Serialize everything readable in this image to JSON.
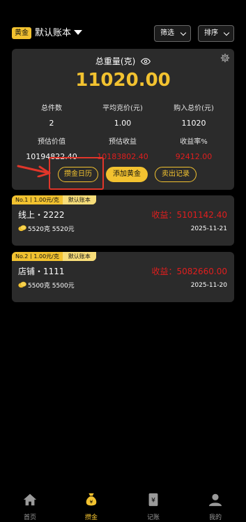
{
  "header": {
    "badge": "黄金",
    "account_name": "默认账本",
    "filter_label": "筛选",
    "sort_label": "排序"
  },
  "summary": {
    "title": "总重量(克)",
    "total_weight": "11020.00",
    "stats": [
      {
        "label": "总件数",
        "value": "2"
      },
      {
        "label": "平均克价(元)",
        "value": "1.00"
      },
      {
        "label": "购入总价(元)",
        "value": "11020"
      },
      {
        "label": "预估价值",
        "value": "10194822.40"
      },
      {
        "label": "预估收益",
        "value": "10183802.40"
      },
      {
        "label": "收益率%",
        "value": "92412.00"
      }
    ],
    "buttons": {
      "calendar": "攒金日历",
      "add": "添加黄金",
      "sell": "卖出记录"
    }
  },
  "records": [
    {
      "number": "No.1丨1.00元/克",
      "account": "默认账本",
      "title": "线上・2222",
      "profit": "收益：5101142.40",
      "weight": "5520克 5520元",
      "date": "2025-11-21"
    },
    {
      "number": "No.2丨1.00元/克",
      "account": "默认账本",
      "title": "店铺・1111",
      "profit": "收益：5082660.00",
      "weight": "5500克 5500元",
      "date": "2025-11-20"
    }
  ],
  "tabbar": {
    "home": "首页",
    "gold": "攒金",
    "book": "记账",
    "mine": "我的"
  },
  "colors": {
    "accent": "#f2c230",
    "profit_red": "#e11e1e",
    "card_bg": "#2b2b2b",
    "highlight": "#e1362a"
  },
  "icons": [
    "gear-icon",
    "eye-icon",
    "coin-icon",
    "home-icon",
    "money-bag-icon",
    "ledger-icon",
    "user-icon",
    "arrow-annotation"
  ]
}
